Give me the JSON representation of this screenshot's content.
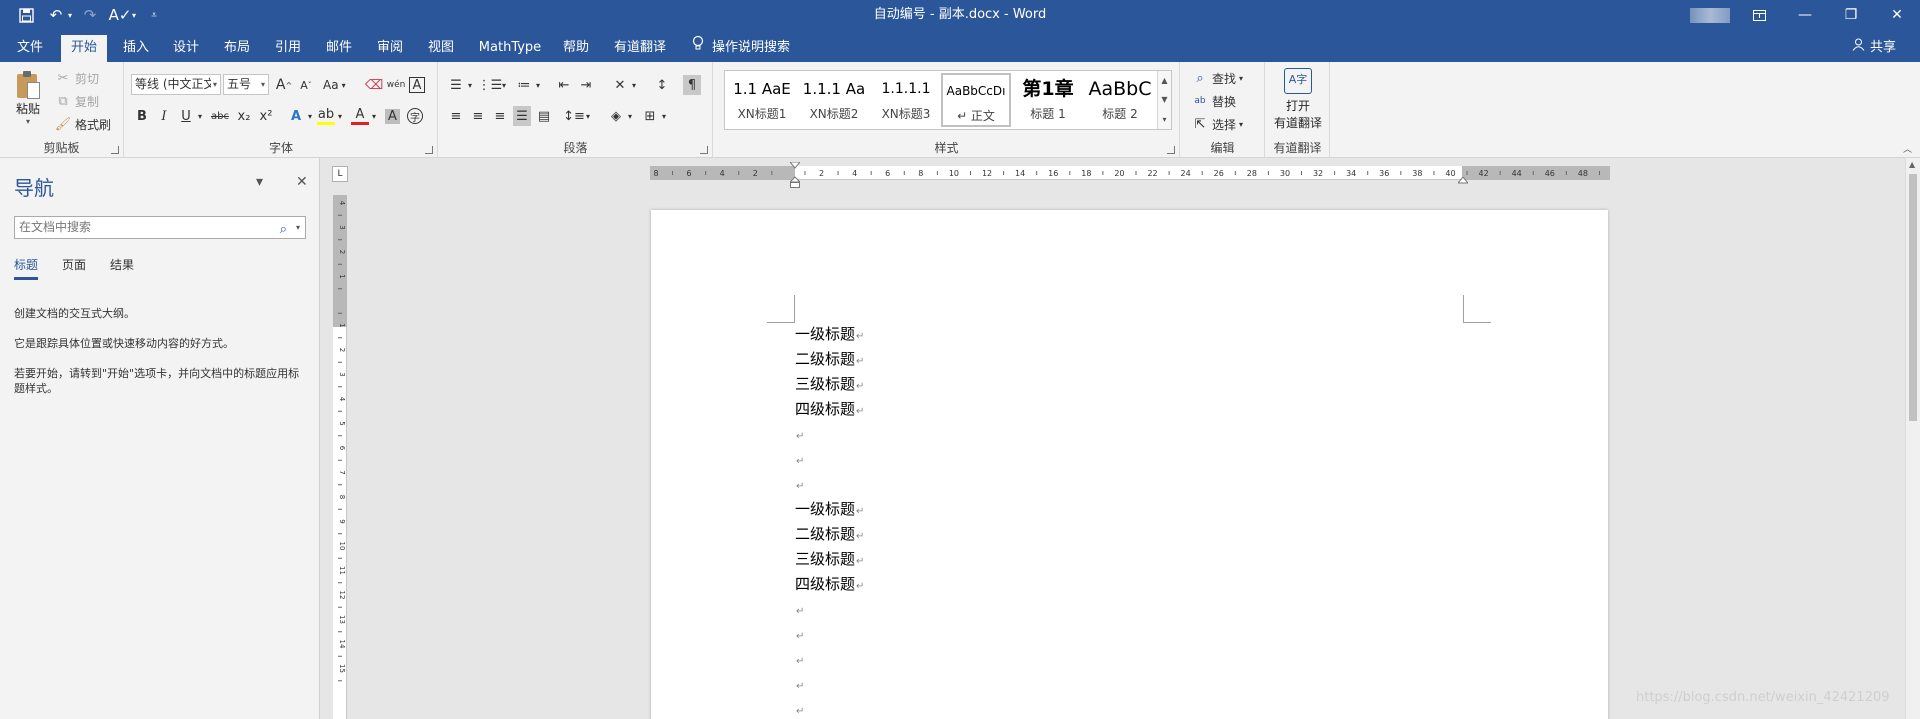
{
  "window": {
    "title": "自动编号 - 副本.docx  -  Word",
    "controls": [
      "ribbon-display",
      "minimize",
      "restore",
      "close"
    ]
  },
  "qat": {
    "icons": [
      "save-icon",
      "undo-icon",
      "redo-icon",
      "spelling-icon",
      "customize-icon"
    ]
  },
  "tabs": [
    "文件",
    "开始",
    "插入",
    "设计",
    "布局",
    "引用",
    "邮件",
    "审阅",
    "视图",
    "MathType",
    "帮助",
    "有道翻译"
  ],
  "active_tab": "开始",
  "tell_me": "操作说明搜索",
  "share": "共享",
  "ribbon": {
    "clipboard": {
      "label": "剪贴板",
      "paste": "粘贴",
      "cut": "剪切",
      "copy": "复制",
      "format_painter": "格式刷"
    },
    "font": {
      "label": "字体",
      "font_name": "等线 (中文正文",
      "font_size": "五号",
      "bold": "B",
      "italic": "I",
      "underline": "U",
      "strike": "abc",
      "subscript": "x₂",
      "superscript": "x²",
      "change_case": "Aa",
      "grow": "A",
      "shrink": "A"
    },
    "paragraph": {
      "label": "段落"
    },
    "styles": {
      "label": "样式",
      "items": [
        {
          "preview": "1.1  AaE",
          "name": "XN标题1"
        },
        {
          "preview": "1.1.1  Aa",
          "name": "XN标题2"
        },
        {
          "preview": "1.1.1.1",
          "name": "XN标题3"
        },
        {
          "preview": "AaBbCcDı",
          "name": "↵ 正文"
        },
        {
          "preview": "第1章",
          "name": "标题 1"
        },
        {
          "preview": "AaBbC",
          "name": "标题 2"
        }
      ]
    },
    "editing": {
      "label": "编辑",
      "find": "查找",
      "replace": "替换",
      "select": "选择"
    },
    "youdao": {
      "label": "有道翻译",
      "open_line1": "打开",
      "open_line2": "有道翻译"
    }
  },
  "nav_pane": {
    "title": "导航",
    "search_placeholder": "在文档中搜索",
    "tabs": [
      "标题",
      "页面",
      "结果"
    ],
    "active_tab": "标题",
    "text1": "创建文档的交互式大纲。",
    "text2": "它是跟踪具体位置或快速移动内容的好方式。",
    "text3": "若要开始，请转到\"开始\"选项卡，并向文档中的标题应用标题样式。"
  },
  "document": {
    "lines": [
      "一级标题",
      "二级标题",
      "三级标题",
      "四级标题",
      "",
      "",
      "",
      "一级标题",
      "二级标题",
      "三级标题",
      "四级标题",
      "",
      "",
      "",
      "",
      ""
    ],
    "paragraph_mark": "↵"
  },
  "ruler": {
    "h_ticks": [
      "8",
      "6",
      "4",
      "2",
      "",
      "2",
      "4",
      "6",
      "8",
      "10",
      "12",
      "14",
      "16",
      "18",
      "20",
      "22",
      "24",
      "26",
      "28",
      "30",
      "32",
      "34",
      "36",
      "38",
      "40",
      "42",
      "44",
      "46",
      "48"
    ],
    "v_ticks": [
      "4",
      "3",
      "2",
      "1",
      "",
      "1",
      "2",
      "3",
      "4",
      "5",
      "6",
      "7",
      "8",
      "9",
      "10",
      "11",
      "12",
      "13",
      "14",
      "15"
    ],
    "tab_selector": "L"
  },
  "watermark": "https://blog.csdn.net/weixin_42421209"
}
